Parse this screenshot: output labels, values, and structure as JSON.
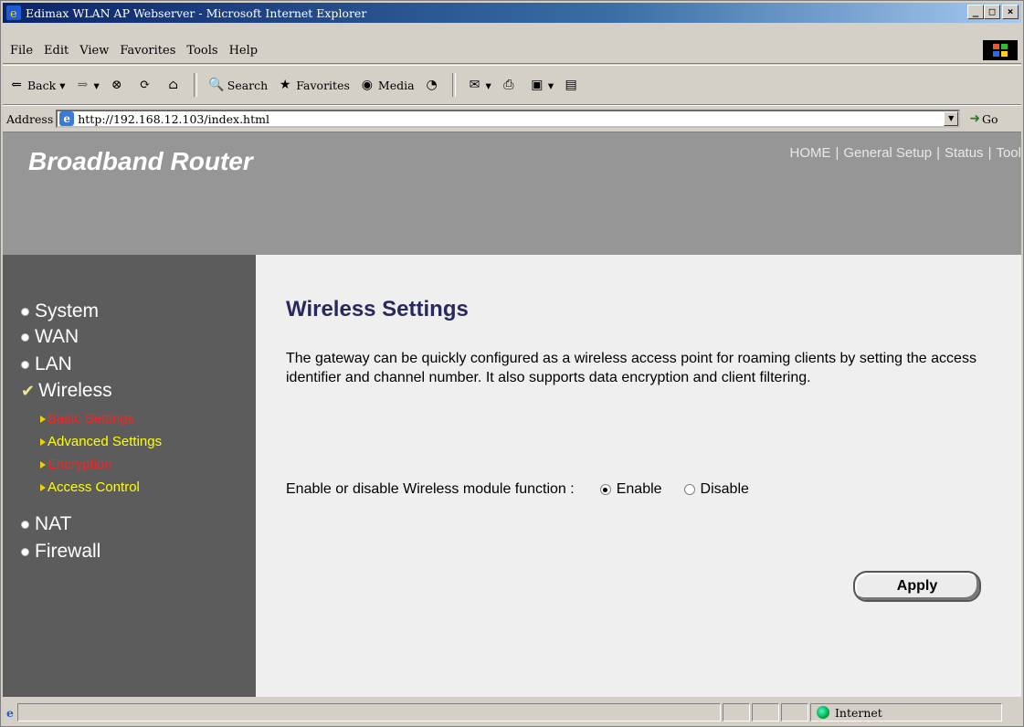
{
  "window": {
    "title": "Edimax WLAN AP Webserver - Microsoft Internet Explorer",
    "minimize": "_",
    "maximize": "□",
    "close": "×"
  },
  "menu": [
    "File",
    "Edit",
    "View",
    "Favorites",
    "Tools",
    "Help"
  ],
  "toolbar": {
    "back": "Back",
    "search": "Search",
    "favorites": "Favorites",
    "media": "Media"
  },
  "address": {
    "label": "Address",
    "url": "http://192.168.12.103/index.html",
    "go": "Go"
  },
  "header": {
    "brand": "Broadband Router",
    "nav": [
      "HOME",
      "General Setup",
      "Status",
      "Tool"
    ]
  },
  "sidebar": {
    "items": [
      {
        "label": "System"
      },
      {
        "label": "WAN"
      },
      {
        "label": "LAN"
      },
      {
        "label": "Wireless"
      },
      {
        "label": "NAT"
      },
      {
        "label": "Firewall"
      }
    ],
    "wireless_sub": [
      {
        "label": "Basic Settings",
        "color": "#ff2020"
      },
      {
        "label": "Advanced Settings",
        "color": "#ffff00"
      },
      {
        "label": "Encryption",
        "color": "#ff2020"
      },
      {
        "label": "Access Control",
        "color": "#ffff00"
      }
    ]
  },
  "main": {
    "title": "Wireless Settings",
    "description": "The gateway can be quickly configured as a wireless access point for roaming clients by setting the access identifier and channel number. It also supports data encryption and client filtering.",
    "enable_label": "Enable or disable Wireless module function :",
    "enable_option": "Enable",
    "disable_option": "Disable",
    "selected": "Enable",
    "apply": "Apply"
  },
  "status": {
    "zone": "Internet"
  },
  "colors": {
    "header_bg": "#969696",
    "sidebar_bg": "#5c5c5c",
    "title_color": "#29295e"
  }
}
